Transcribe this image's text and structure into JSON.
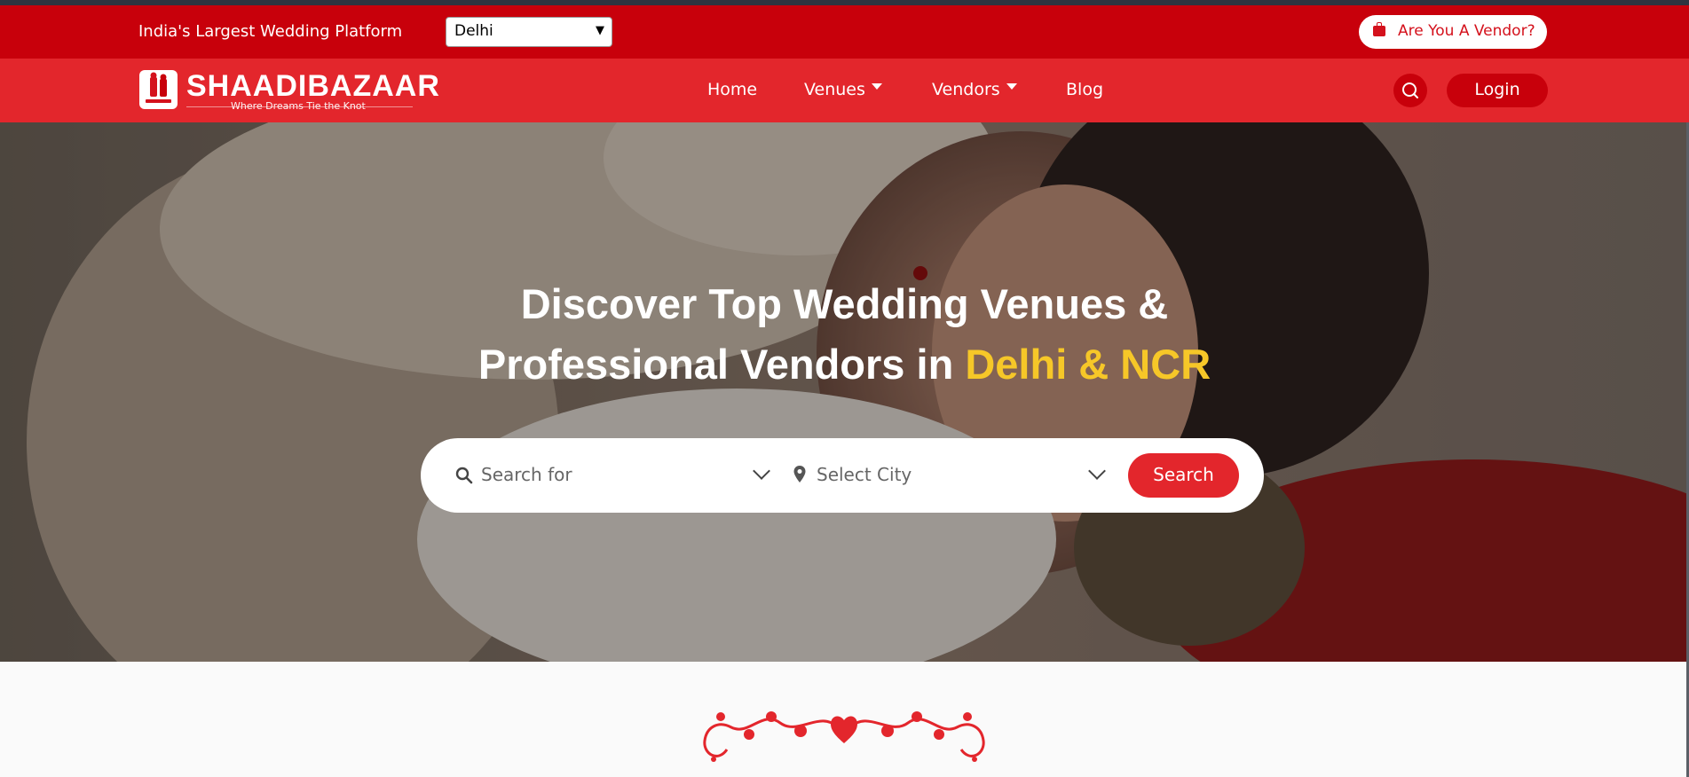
{
  "topbar": {
    "tagline": "India's Largest Wedding Platform",
    "city_select": "Delhi",
    "vendor_button": "Are You A Vendor?"
  },
  "navbar": {
    "logo_text": "SHAADIBAZAAR",
    "logo_tagline": "Where Dreams Tie the Knot",
    "items": [
      {
        "label": "Home"
      },
      {
        "label": "Venues"
      },
      {
        "label": "Vendors"
      },
      {
        "label": "Blog"
      }
    ],
    "login": "Login"
  },
  "hero": {
    "heading_line1": "Discover Top Wedding Venues &",
    "heading_line2_prefix": "Professional Vendors in",
    "heading_highlight": "Delhi & NCR",
    "search_placeholder": "Search for",
    "city_placeholder": "Select City",
    "search_button": "Search"
  },
  "colors": {
    "topbar": "#c8000b",
    "navbar": "#e3262c",
    "highlight": "#f6c728"
  },
  "icons": [
    "briefcase-icon",
    "search-icon",
    "chevron-down-icon",
    "map-pin-icon",
    "heart-ornament-icon"
  ]
}
